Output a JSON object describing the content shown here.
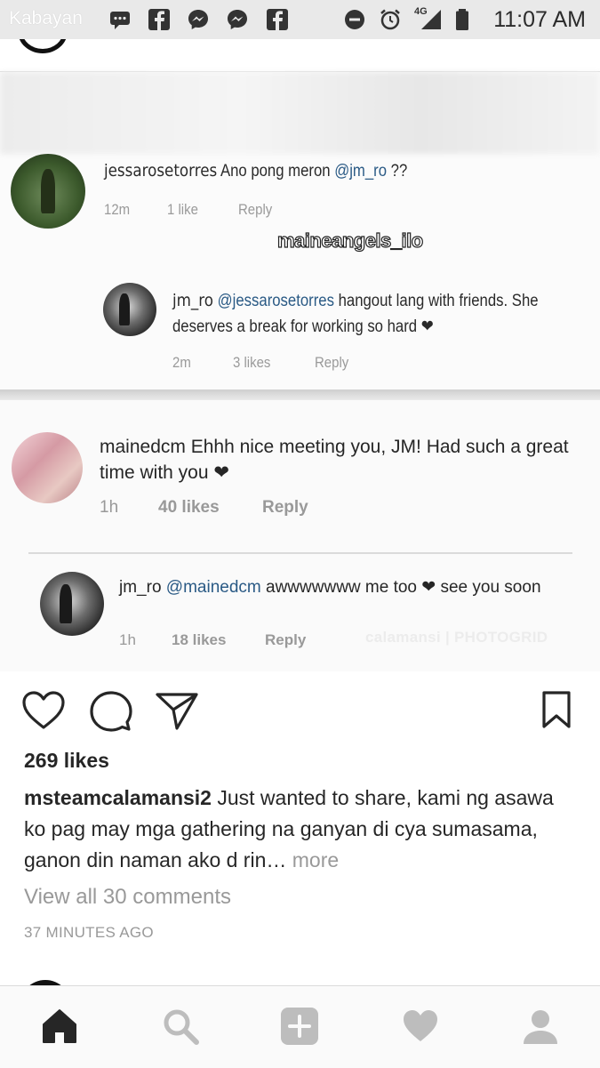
{
  "status_bar": {
    "carrier": "Kabayan",
    "network": "4G",
    "time": "11:07 AM"
  },
  "embedded_thread": {
    "comment1": {
      "username": "jessarosetorres",
      "text": "Ano pong meron",
      "mention": "@jm_ro",
      "suffix": "??",
      "time": "12m",
      "likes": "1 like",
      "reply": "Reply"
    },
    "watermark": "maineangels_ilo",
    "comment2": {
      "username": "jm_ro",
      "mention": "@jessarosetorres",
      "text": "hangout lang with friends. She deserves a break for working so hard",
      "time": "2m",
      "likes": "3 likes",
      "reply": "Reply"
    },
    "comment3": {
      "username": "mainedcm",
      "text": "Ehhh nice meeting you, JM! Had such a great time with you",
      "time": "1h",
      "likes": "40 likes",
      "reply": "Reply"
    },
    "comment4": {
      "username": "jm_ro",
      "mention": "@mainedcm",
      "text": "awwwwwww me too",
      "text2": "see you soon",
      "time": "1h",
      "likes": "18 likes",
      "reply": "Reply"
    },
    "photo_watermark": "calamansi | PHOTOGRID"
  },
  "post": {
    "likes": "269 likes",
    "caption_user": "msteamcalamansi2",
    "caption_text": "Just wanted to share, kami ng asawa ko pag may mga gathering na ganyan di cya sumasama, ganon din naman ako d rin…",
    "more": "more",
    "view_all": "View all 30 comments",
    "time_ago": "37 MINUTES AGO"
  },
  "icons": {
    "like": "heart-outline-icon",
    "comment": "comment-bubble-icon",
    "share": "send-paper-plane-icon",
    "save": "bookmark-icon"
  },
  "nav": [
    "home-icon",
    "search-icon",
    "add-post-icon",
    "activity-heart-icon",
    "profile-icon"
  ],
  "colors": {
    "text": "#262626",
    "secondary": "#999999",
    "mention": "#2a5a85"
  }
}
